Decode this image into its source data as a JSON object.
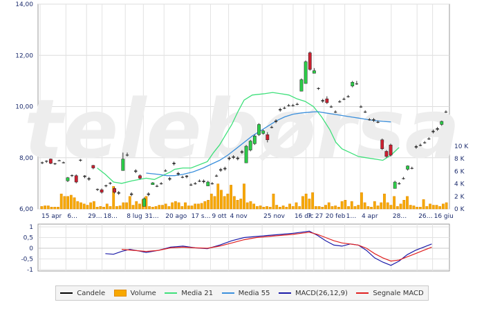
{
  "watermark": "telebørsa",
  "legend": [
    {
      "label": "Candele",
      "type": "line",
      "color": "#000000"
    },
    {
      "label": "Volume",
      "type": "bar",
      "color": "#f7a800"
    },
    {
      "label": "Media 21",
      "type": "line",
      "color": "#3de07a"
    },
    {
      "label": "Media 55",
      "type": "line",
      "color": "#3a8fdc"
    },
    {
      "label": "MACD(26,12,9)",
      "type": "line",
      "color": "#1a1aa8"
    },
    {
      "label": "Segnale MACD",
      "type": "line",
      "color": "#e02020"
    }
  ],
  "chart_data": [
    {
      "type": "candlestick",
      "ylim": [
        6,
        14
      ],
      "y_ticks": [
        "6,00",
        "8,00",
        "10,00",
        "12,00",
        "14,00"
      ],
      "volume_ylim": [
        0,
        10
      ],
      "volume_ticks": [
        "0 K",
        "2 K",
        "4 K",
        "6 K",
        "8 K",
        "10 K"
      ],
      "x_ticks": [
        "15 apr",
        "6…",
        "29…",
        "18…",
        "8 lug",
        "31…",
        "20 ago",
        "17 s…",
        "9 ott",
        "4 nov",
        "25 nov",
        "16 dic",
        "7",
        "27",
        "20 feb",
        "1…",
        "4 apr",
        "28…",
        "26…",
        "16 giu"
      ],
      "grid": true,
      "candles": [
        [
          7.8,
          7.85,
          7.75,
          7.82
        ],
        [
          7.85,
          7.9,
          7.8,
          7.88
        ],
        [
          7.95,
          7.97,
          7.75,
          7.78
        ],
        [
          7.78,
          7.8,
          7.72,
          7.76
        ],
        [
          7.9,
          7.92,
          7.88,
          7.9
        ],
        [
          7.82,
          7.85,
          7.78,
          7.8
        ],
        [
          7.1,
          7.25,
          7.05,
          7.22
        ],
        [
          7.3,
          7.35,
          7.25,
          7.32
        ],
        [
          7.3,
          7.35,
          7.0,
          7.05
        ],
        [
          7.9,
          7.95,
          7.85,
          7.92
        ],
        [
          7.3,
          7.32,
          7.2,
          7.25
        ],
        [
          7.2,
          7.25,
          7.1,
          7.15
        ],
        [
          7.7,
          7.72,
          7.55,
          7.6
        ],
        [
          6.75,
          6.8,
          6.7,
          6.78
        ],
        [
          6.75,
          6.8,
          6.6,
          6.65
        ],
        [
          6.9,
          6.95,
          6.85,
          6.92
        ],
        [
          7.0,
          7.05,
          6.95,
          7.02
        ],
        [
          6.8,
          6.85,
          6.6,
          6.65
        ],
        [
          6.65,
          6.7,
          6.55,
          6.6
        ],
        [
          7.5,
          8.2,
          7.5,
          7.95
        ],
        [
          8.1,
          8.2,
          8.05,
          8.12
        ],
        [
          6.6,
          6.65,
          6.5,
          6.55
        ],
        [
          7.5,
          7.55,
          7.4,
          7.45
        ],
        [
          7.3,
          7.35,
          7.15,
          7.2
        ],
        [
          6.1,
          6.45,
          6.1,
          6.4
        ],
        [
          6.6,
          6.65,
          6.5,
          6.55
        ],
        [
          6.95,
          7.05,
          6.95,
          7.02
        ],
        [
          6.9,
          6.95,
          6.85,
          6.9
        ],
        [
          7.0,
          7.05,
          6.95,
          7.0
        ],
        [
          7.5,
          7.55,
          7.45,
          7.5
        ],
        [
          7.15,
          7.25,
          7.1,
          7.2
        ],
        [
          7.8,
          7.85,
          7.7,
          7.75
        ],
        [
          7.4,
          7.45,
          7.3,
          7.35
        ],
        [
          7.25,
          7.3,
          7.2,
          7.25
        ],
        [
          7.3,
          7.32,
          7.2,
          7.25
        ],
        [
          6.95,
          7.0,
          6.9,
          6.95
        ],
        [
          7.0,
          7.05,
          6.95,
          7.0
        ],
        [
          7.1,
          7.15,
          7.05,
          7.1
        ],
        [
          7.1,
          7.15,
          7.0,
          7.05
        ],
        [
          6.9,
          7.1,
          6.9,
          7.05
        ],
        [
          7.0,
          7.05,
          6.95,
          7.0
        ],
        [
          7.3,
          7.35,
          7.25,
          7.3
        ],
        [
          7.5,
          7.6,
          7.45,
          7.55
        ],
        [
          7.55,
          7.65,
          7.5,
          7.6
        ],
        [
          7.95,
          8.05,
          7.9,
          8.0
        ],
        [
          8.0,
          8.1,
          7.95,
          8.05
        ],
        [
          8.0,
          8.05,
          7.9,
          7.95
        ],
        [
          8.2,
          8.3,
          8.15,
          8.25
        ],
        [
          7.8,
          8.5,
          7.8,
          8.45
        ],
        [
          8.3,
          8.7,
          8.25,
          8.65
        ],
        [
          8.55,
          8.9,
          8.5,
          8.85
        ],
        [
          8.9,
          9.35,
          8.85,
          9.3
        ],
        [
          8.95,
          9.1,
          8.9,
          9.05
        ],
        [
          8.9,
          9.0,
          8.6,
          8.7
        ],
        [
          9.2,
          9.25,
          9.15,
          9.2
        ],
        [
          9.4,
          9.5,
          9.35,
          9.45
        ],
        [
          9.85,
          9.95,
          9.8,
          9.9
        ],
        [
          9.95,
          10.0,
          9.9,
          9.95
        ],
        [
          10.05,
          10.1,
          10.0,
          10.05
        ],
        [
          10.05,
          10.1,
          10.0,
          10.05
        ],
        [
          10.1,
          10.15,
          10.05,
          10.1
        ],
        [
          10.6,
          11.1,
          10.6,
          11.05
        ],
        [
          10.9,
          11.8,
          10.9,
          11.75
        ],
        [
          12.1,
          12.15,
          11.4,
          11.45
        ],
        [
          11.3,
          11.5,
          11.3,
          11.4
        ],
        [
          10.7,
          10.75,
          10.65,
          10.72
        ],
        [
          10.2,
          10.3,
          10.15,
          10.25
        ],
        [
          10.3,
          10.4,
          10.1,
          10.15
        ],
        [
          10.0,
          10.05,
          9.95,
          10.0
        ],
        [
          9.8,
          9.85,
          9.75,
          9.8
        ],
        [
          10.2,
          10.25,
          10.15,
          10.2
        ],
        [
          10.3,
          10.35,
          10.25,
          10.3
        ],
        [
          10.4,
          10.45,
          10.35,
          10.4
        ],
        [
          10.8,
          11.0,
          10.75,
          10.95
        ],
        [
          10.9,
          11.0,
          10.85,
          10.9
        ],
        [
          10.0,
          10.05,
          9.95,
          10.0
        ],
        [
          9.8,
          9.85,
          9.75,
          9.8
        ],
        [
          9.5,
          9.55,
          9.45,
          9.5
        ],
        [
          9.5,
          9.55,
          9.4,
          9.45
        ],
        [
          9.4,
          9.45,
          9.35,
          9.4
        ],
        [
          8.7,
          8.75,
          8.3,
          8.35
        ],
        [
          8.25,
          8.3,
          8.0,
          8.05
        ],
        [
          8.5,
          8.55,
          8.05,
          8.1
        ],
        [
          6.8,
          7.1,
          6.8,
          7.05
        ],
        [
          7.0,
          7.05,
          6.95,
          7.0
        ],
        [
          7.2,
          7.25,
          7.15,
          7.2
        ],
        [
          7.55,
          7.7,
          7.5,
          7.68
        ],
        [
          7.6,
          7.65,
          7.55,
          7.6
        ],
        [
          8.4,
          8.5,
          8.35,
          8.45
        ],
        [
          8.5,
          8.55,
          8.45,
          8.5
        ],
        [
          8.6,
          8.65,
          8.55,
          8.6
        ],
        [
          8.75,
          8.8,
          8.7,
          8.75
        ],
        [
          9.0,
          9.1,
          8.95,
          9.05
        ],
        [
          9.1,
          9.2,
          9.05,
          9.15
        ],
        [
          9.3,
          9.45,
          9.25,
          9.42
        ],
        [
          9.8,
          9.85,
          9.75,
          9.8
        ]
      ],
      "volume": [
        0.4,
        0.5,
        0.5,
        0.3,
        0.3,
        0.3,
        2.4,
        2.0,
        2.0,
        2.2,
        1.8,
        1.2,
        1.0,
        0.8,
        0.6,
        1.0,
        1.2,
        0.3,
        0.4,
        0.3,
        0.8,
        0.4,
        3.6,
        0.4,
        0.5,
        1.0,
        1.0,
        2.0,
        0.6,
        1.2,
        0.8,
        1.5,
        2.0,
        0.4,
        0.3,
        0.4,
        0.6,
        0.6,
        0.8,
        0.4,
        1.0,
        1.2,
        1.0,
        0.4,
        1.0,
        0.5,
        0.5,
        0.8,
        0.8,
        0.9,
        1.2,
        1.4,
        2.4,
        2.0,
        4.0,
        3.0,
        2.0,
        2.4,
        3.8,
        2.0,
        1.4,
        1.6,
        4.0,
        1.0,
        1.2,
        0.8,
        0.4,
        0.5,
        0.3,
        0.4,
        0.3,
        2.4,
        0.6,
        0.3,
        0.5,
        0.3,
        0.8,
        0.4,
        1.0,
        0.4,
        2.0,
        2.4,
        1.6,
        2.6,
        0.4,
        0.4,
        0.3,
        0.6,
        1.0,
        0.4,
        0.5,
        0.3,
        1.2,
        1.4,
        0.4,
        1.2,
        0.4,
        0.6,
        2.6,
        1.0,
        0.4,
        0.3,
        1.2,
        0.5,
        1.0,
        2.4,
        1.0,
        0.6,
        2.0,
        0.4,
        0.8,
        1.4,
        2.0,
        0.6,
        0.5,
        0.3,
        0.3,
        1.5,
        0.4,
        0.8,
        0.6,
        0.6,
        0.4,
        0.8,
        1.0
      ],
      "media21": [
        [
          28,
          7.6
        ],
        [
          32,
          7.35
        ],
        [
          36,
          7.05
        ],
        [
          40,
          7.0
        ],
        [
          45,
          7.1
        ],
        [
          52,
          7.2
        ],
        [
          56,
          7.15
        ],
        [
          60,
          7.3
        ],
        [
          64,
          7.45
        ],
        [
          66,
          7.55
        ],
        [
          70,
          7.6
        ],
        [
          74,
          7.6
        ],
        [
          82,
          7.85
        ],
        [
          85,
          8.2
        ],
        [
          88,
          8.5
        ],
        [
          91,
          8.9
        ],
        [
          94,
          9.3
        ],
        [
          97,
          9.8
        ],
        [
          100,
          10.25
        ],
        [
          104,
          10.45
        ],
        [
          110,
          10.5
        ],
        [
          114,
          10.55
        ],
        [
          118,
          10.5
        ],
        [
          122,
          10.45
        ],
        [
          126,
          10.3
        ],
        [
          130,
          10.2
        ],
        [
          134,
          10.0
        ],
        [
          138,
          9.6
        ],
        [
          142,
          9.1
        ],
        [
          145,
          8.6
        ],
        [
          148,
          8.35
        ],
        [
          152,
          8.2
        ],
        [
          156,
          8.05
        ],
        [
          160,
          8.0
        ],
        [
          164,
          7.95
        ],
        [
          168,
          7.9
        ],
        [
          172,
          8.1
        ],
        [
          176,
          8.4
        ]
      ],
      "media55": [
        [
          52,
          7.4
        ],
        [
          58,
          7.35
        ],
        [
          62,
          7.3
        ],
        [
          66,
          7.3
        ],
        [
          70,
          7.35
        ],
        [
          75,
          7.45
        ],
        [
          80,
          7.6
        ],
        [
          84,
          7.75
        ],
        [
          88,
          7.9
        ],
        [
          92,
          8.1
        ],
        [
          96,
          8.35
        ],
        [
          100,
          8.6
        ],
        [
          104,
          8.85
        ],
        [
          108,
          9.05
        ],
        [
          112,
          9.25
        ],
        [
          116,
          9.45
        ],
        [
          120,
          9.6
        ],
        [
          124,
          9.7
        ],
        [
          128,
          9.75
        ],
        [
          132,
          9.78
        ],
        [
          136,
          9.8
        ],
        [
          140,
          9.75
        ],
        [
          144,
          9.7
        ],
        [
          148,
          9.65
        ],
        [
          152,
          9.6
        ],
        [
          156,
          9.55
        ],
        [
          160,
          9.5
        ],
        [
          164,
          9.45
        ],
        [
          168,
          9.42
        ],
        [
          172,
          9.4
        ]
      ]
    },
    {
      "type": "line",
      "ylim": [
        -1,
        1
      ],
      "y_ticks": [
        "-1",
        "-0,5",
        "0",
        "0,5",
        "1"
      ],
      "series": [
        {
          "name": "MACD(26,12,9)",
          "points": [
            [
              32,
              -0.25
            ],
            [
              36,
              -0.28
            ],
            [
              40,
              -0.15
            ],
            [
              44,
              -0.05
            ],
            [
              48,
              -0.12
            ],
            [
              52,
              -0.2
            ],
            [
              58,
              -0.1
            ],
            [
              64,
              0.05
            ],
            [
              70,
              0.1
            ],
            [
              76,
              0.02
            ],
            [
              82,
              -0.02
            ],
            [
              88,
              0.15
            ],
            [
              94,
              0.35
            ],
            [
              100,
              0.5
            ],
            [
              106,
              0.55
            ],
            [
              112,
              0.6
            ],
            [
              118,
              0.65
            ],
            [
              124,
              0.7
            ],
            [
              128,
              0.75
            ],
            [
              132,
              0.8
            ],
            [
              136,
              0.6
            ],
            [
              140,
              0.35
            ],
            [
              144,
              0.15
            ],
            [
              148,
              0.1
            ],
            [
              152,
              0.2
            ],
            [
              156,
              0.15
            ],
            [
              160,
              -0.1
            ],
            [
              164,
              -0.45
            ],
            [
              168,
              -0.65
            ],
            [
              172,
              -0.8
            ],
            [
              176,
              -0.6
            ],
            [
              180,
              -0.3
            ],
            [
              184,
              -0.1
            ],
            [
              188,
              0.05
            ],
            [
              192,
              0.2
            ]
          ]
        },
        {
          "name": "Segnale MACD",
          "points": [
            [
              40,
              -0.05
            ],
            [
              46,
              -0.1
            ],
            [
              52,
              -0.15
            ],
            [
              58,
              -0.1
            ],
            [
              64,
              0.02
            ],
            [
              70,
              0.05
            ],
            [
              76,
              0.02
            ],
            [
              82,
              0.0
            ],
            [
              88,
              0.1
            ],
            [
              94,
              0.25
            ],
            [
              100,
              0.4
            ],
            [
              106,
              0.5
            ],
            [
              112,
              0.55
            ],
            [
              118,
              0.6
            ],
            [
              124,
              0.65
            ],
            [
              128,
              0.7
            ],
            [
              132,
              0.75
            ],
            [
              136,
              0.65
            ],
            [
              140,
              0.5
            ],
            [
              144,
              0.35
            ],
            [
              148,
              0.25
            ],
            [
              152,
              0.2
            ],
            [
              156,
              0.15
            ],
            [
              160,
              0.0
            ],
            [
              164,
              -0.25
            ],
            [
              168,
              -0.45
            ],
            [
              172,
              -0.6
            ],
            [
              176,
              -0.55
            ],
            [
              180,
              -0.4
            ],
            [
              184,
              -0.25
            ],
            [
              188,
              -0.1
            ],
            [
              192,
              0.05
            ]
          ]
        }
      ]
    }
  ]
}
